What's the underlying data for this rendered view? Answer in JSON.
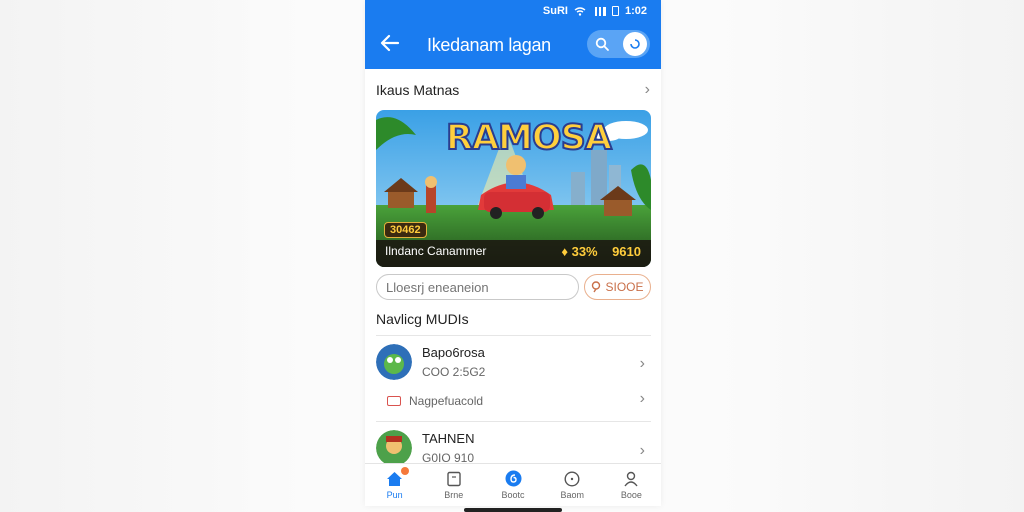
{
  "status_bar": {
    "carrier": "SuRI",
    "battery": "1:02"
  },
  "header": {
    "title": "Ikedanam lagan"
  },
  "section": {
    "title": "Ikaus Matnas"
  },
  "banner": {
    "logo_text": "RAMOSA",
    "caption": "Ilndanc Canammer",
    "score_badge": "30462",
    "stats_percent": "33%",
    "stats_count": "9610"
  },
  "search": {
    "placeholder": "Lloesrj eneaneion"
  },
  "small_button": {
    "label": "SIOOE"
  },
  "list": {
    "title": "Navlicg MUDIs",
    "items": [
      {
        "name": "Bapo6rosa",
        "sub": "COO 2:5G2"
      },
      {
        "name": "TAHNEN",
        "sub": "G0IO 910"
      }
    ],
    "sub_link": "Nagpefuacold"
  },
  "bottom_nav": [
    {
      "label": "Pun",
      "icon": "home-icon",
      "active": true
    },
    {
      "label": "Brne",
      "icon": "book-icon",
      "active": false
    },
    {
      "label": "Bootc",
      "icon": "game-icon",
      "active": false
    },
    {
      "label": "Baom",
      "icon": "clock-icon",
      "active": false
    },
    {
      "label": "Booe",
      "icon": "profile-icon",
      "active": false
    }
  ],
  "colors": {
    "primary": "#1a7cf0",
    "accent": "#f5793b"
  }
}
